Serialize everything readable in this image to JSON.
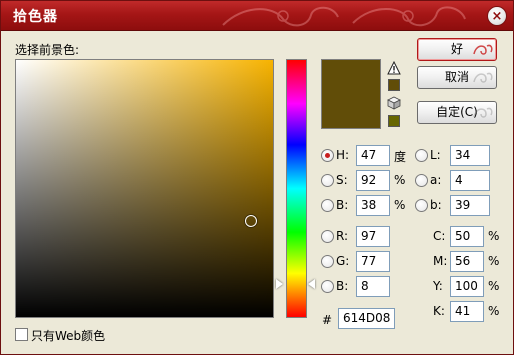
{
  "window": {
    "title": "拾色器",
    "close_symbol": "×"
  },
  "picker_label": "选择前景色:",
  "buttons": {
    "ok": "好",
    "cancel": "取消",
    "custom": "自定(C)"
  },
  "colors": {
    "new": "#614D08",
    "current": "#614D08",
    "gamut_swatch": "#614D08",
    "websafe_swatch": "#666600",
    "hue_base": "#f7b300"
  },
  "icons": {
    "gamut": "warning-triangle-icon",
    "websafe": "cube-icon"
  },
  "hsb": {
    "h": {
      "label": "H:",
      "value": "47",
      "unit": "度"
    },
    "s": {
      "label": "S:",
      "value": "92",
      "unit": "%"
    },
    "b": {
      "label": "B:",
      "value": "38",
      "unit": "%"
    }
  },
  "rgb": {
    "r": {
      "label": "R:",
      "value": "97"
    },
    "g": {
      "label": "G:",
      "value": "77"
    },
    "b": {
      "label": "B:",
      "value": "8"
    }
  },
  "lab": {
    "l": {
      "label": "L:",
      "value": "34"
    },
    "a": {
      "label": "a:",
      "value": "4"
    },
    "b": {
      "label": "b:",
      "value": "39"
    }
  },
  "cmyk": {
    "c": {
      "label": "C:",
      "value": "50",
      "unit": "%"
    },
    "m": {
      "label": "M:",
      "value": "56",
      "unit": "%"
    },
    "y": {
      "label": "Y:",
      "value": "100",
      "unit": "%"
    },
    "k": {
      "label": "K:",
      "value": "41",
      "unit": "%"
    }
  },
  "hex": {
    "label": "#",
    "value": "614D08"
  },
  "web_only": {
    "label": "只有Web颜色",
    "checked": false
  },
  "selected_mode": "H"
}
